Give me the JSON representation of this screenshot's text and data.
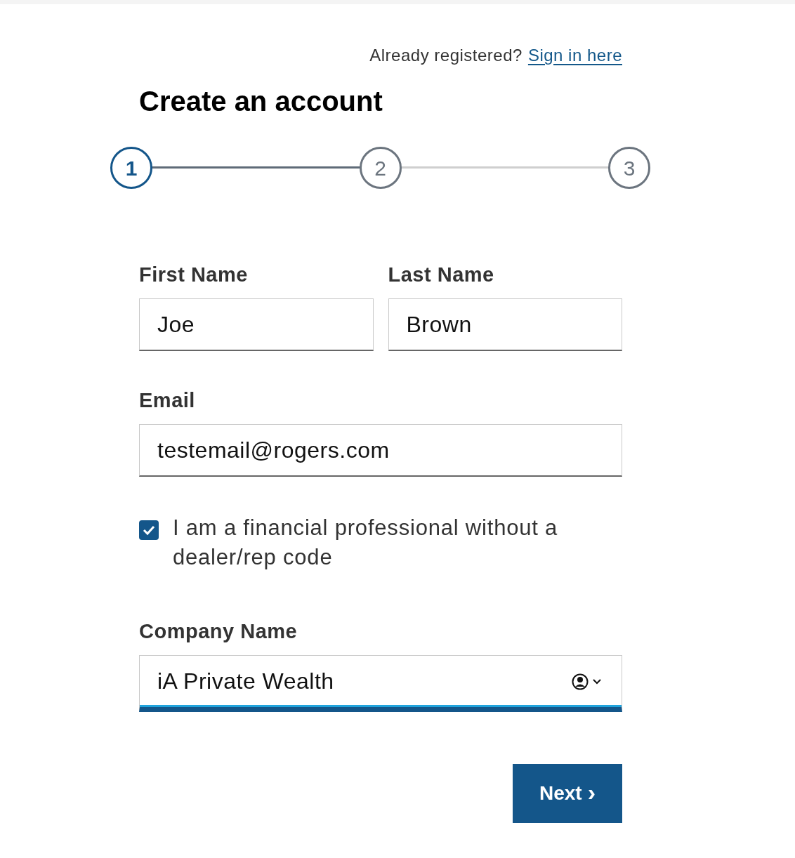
{
  "sign_in": {
    "prompt": "Already registered?",
    "link": "Sign in here"
  },
  "title": "Create an account",
  "steps": [
    {
      "label": "1",
      "selected": true
    },
    {
      "label": "2",
      "selected": false
    },
    {
      "label": "3",
      "selected": false
    }
  ],
  "name_fields": [
    {
      "label": "First Name",
      "value": "Joe",
      "focused": false
    },
    {
      "label": "Last Name",
      "value": "Brown",
      "focused": false
    }
  ],
  "email": {
    "label": "Email",
    "value": "testemail@rogers.com",
    "focused": false
  },
  "professional_checkbox": {
    "label": "I am a financial professional without a dealer/rep code",
    "checked": true
  },
  "company": {
    "label": "Company Name",
    "value": "iA Private Wealth",
    "focused": true
  },
  "next_button": {
    "label": "Next",
    "icon": "›"
  }
}
